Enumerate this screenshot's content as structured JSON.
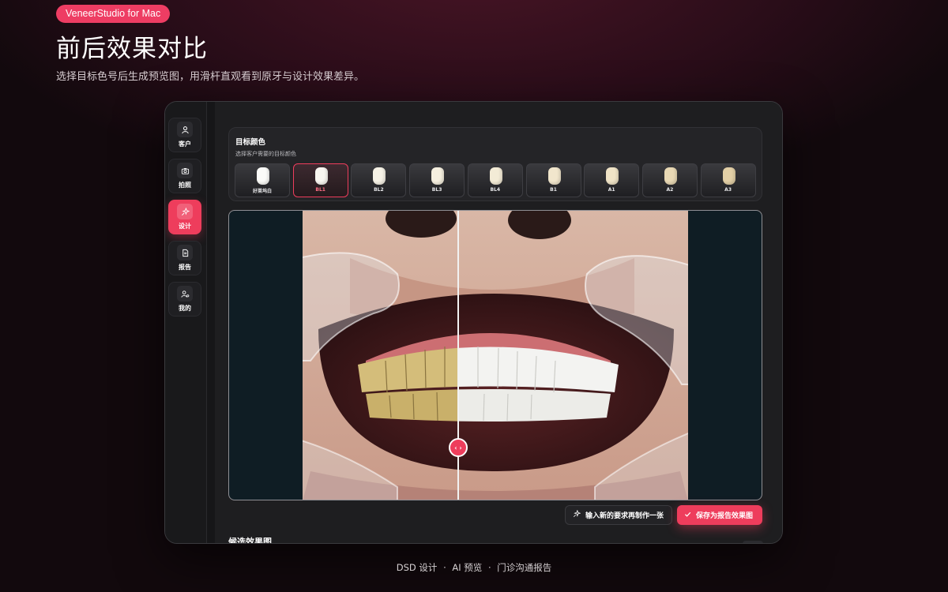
{
  "badge": "VeneerStudio for Mac",
  "hero": {
    "title": "前后效果对比",
    "subtitle": "选择目标色号后生成预览图，用滑杆直观看到原牙与设计效果差异。"
  },
  "sidebar": {
    "items": [
      {
        "label": "客户",
        "icon": "user-icon"
      },
      {
        "label": "拍照",
        "icon": "camera-icon"
      },
      {
        "label": "设计",
        "icon": "sparkle-icon",
        "active": true
      },
      {
        "label": "报告",
        "icon": "document-icon"
      },
      {
        "label": "我的",
        "icon": "profile-settings-icon"
      }
    ]
  },
  "color_panel": {
    "title": "目标颜色",
    "subtitle": "选择客户需要的目标颜色",
    "swatches": [
      {
        "label": "好莱坞白",
        "color": "#fbfbf8"
      },
      {
        "label": "BL1",
        "color": "#f8f6f0",
        "selected": true
      },
      {
        "label": "BL2",
        "color": "#f6f2e6"
      },
      {
        "label": "BL3",
        "color": "#f5efdf"
      },
      {
        "label": "BL4",
        "color": "#f3ebd6"
      },
      {
        "label": "B1",
        "color": "#f1e6cc"
      },
      {
        "label": "A1",
        "color": "#efe3c6"
      },
      {
        "label": "A2",
        "color": "#e8d8b4"
      },
      {
        "label": "A3",
        "color": "#e2cfa6"
      }
    ]
  },
  "compare": {
    "slider_position": 0.4,
    "handle_glyph": "‹ ›"
  },
  "actions": {
    "regenerate_label": "输入新的要求再制作一张",
    "save_label": "保存为报告效果图"
  },
  "candidates": {
    "title": "候选效果图"
  },
  "footer": {
    "item1": "DSD 设计",
    "item2": "AI 预览",
    "item3": "门诊沟通报告",
    "separator": "·"
  },
  "colors": {
    "accent": "#ee3d5c",
    "badge": "#ee3d63",
    "window_bg": "#1c1c1e"
  }
}
